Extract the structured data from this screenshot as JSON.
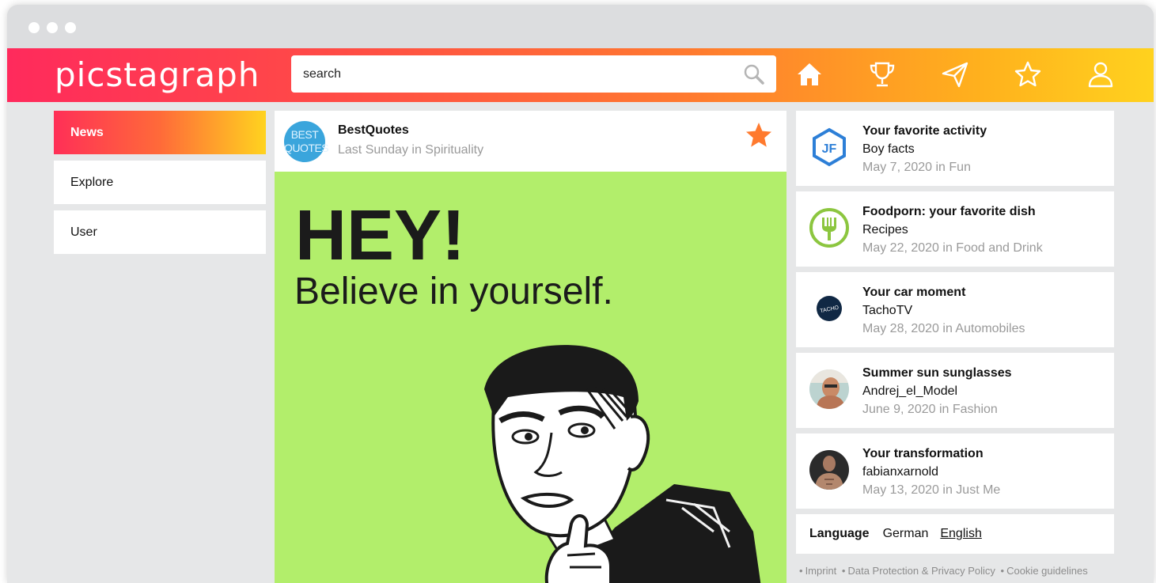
{
  "app": {
    "logo_text": "picstagraph",
    "brand_gradient": [
      "#ff2a5c",
      "#ff7b2f",
      "#ffd21e"
    ]
  },
  "search": {
    "placeholder": "search"
  },
  "nav_icons": [
    "home-icon",
    "trophy-icon",
    "paper-plane-icon",
    "star-icon",
    "user-icon"
  ],
  "sidebar": {
    "items": [
      {
        "label": "News",
        "active": true
      },
      {
        "label": "Explore",
        "active": false
      },
      {
        "label": "User",
        "active": false
      }
    ]
  },
  "post": {
    "author": "BestQuotes",
    "avatar_text": [
      "BEST",
      "QUOTES"
    ],
    "meta": "Last Sunday in Spirituality",
    "favorite": true,
    "favorite_color": "#ff7a2e",
    "image": {
      "headline": "HEY!",
      "subline": "Believe in yourself.",
      "background": "#b2ee6b"
    }
  },
  "feed": [
    {
      "title": "Your favorite activity",
      "subtitle": "Boy facts",
      "meta": "May 7, 2020 in Fun",
      "avatar": "jf-hexagon-logo"
    },
    {
      "title": "Foodporn: your favorite dish",
      "subtitle": "Recipes",
      "meta": "May 22, 2020 in Food and Drink",
      "avatar": "fork-logo"
    },
    {
      "title": "Your car moment",
      "subtitle": "TachoTV",
      "meta": "May 28, 2020 in Automobiles",
      "avatar": "tacho-logo",
      "avatar_text": "TACHO"
    },
    {
      "title": "Summer sun sunglasses",
      "subtitle": "Andrej_el_Model",
      "meta": "June 9, 2020 in Fashion",
      "avatar": "user-photo"
    },
    {
      "title": "Your transformation",
      "subtitle": "fabianxarnold",
      "meta": "May 13, 2020 in Just Me",
      "avatar": "user-photo"
    }
  ],
  "language": {
    "label": "Language",
    "options": [
      "German",
      "English"
    ],
    "selected": "English"
  },
  "footer_links": [
    "Imprint",
    "Data Protection & Privacy Policy",
    "Cookie guidelines"
  ]
}
